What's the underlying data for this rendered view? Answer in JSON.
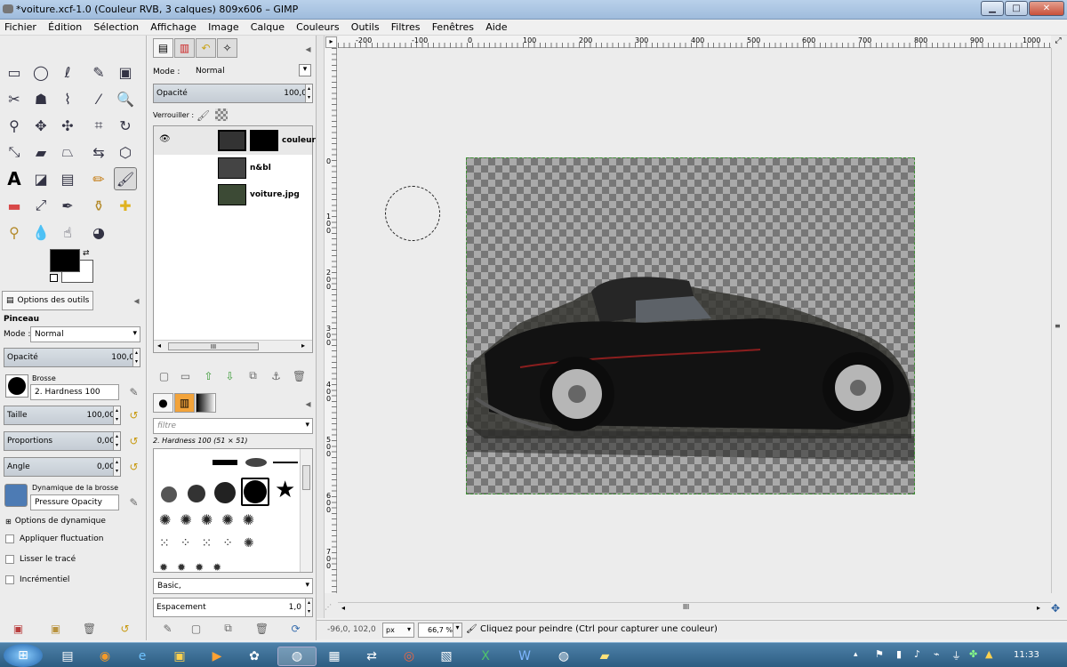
{
  "window": {
    "title": "*voiture.xcf-1.0 (Couleur RVB, 3 calques) 809x606 – GIMP",
    "minimize": "▁",
    "maximize": "□",
    "close": "✕"
  },
  "menu": [
    "Fichier",
    "Édition",
    "Sélection",
    "Affichage",
    "Image",
    "Calque",
    "Couleurs",
    "Outils",
    "Filtres",
    "Fenêtres",
    "Aide"
  ],
  "toolbox": {
    "tools": [
      "rect-select",
      "ellipse-select",
      "lasso",
      "fuzzy-select",
      "color-select",
      "scissors",
      "foreground-select",
      "paths",
      "color-picker",
      "zoom",
      "measure",
      "move",
      "align",
      "crop",
      "rotate",
      "scale",
      "shear",
      "perspective",
      "flip",
      "cage",
      "text",
      "bucket-fill",
      "blend",
      "pencil",
      "paintbrush",
      "eraser",
      "airbrush",
      "ink",
      "clone",
      "heal",
      "perspective-clone",
      "blur",
      "smudge",
      "dodge-burn"
    ],
    "foreground": "#000000",
    "background": "#ffffff"
  },
  "toolOptions": {
    "tabTitle": "Options des outils",
    "toolName": "Pinceau",
    "modeLabel": "Mode :",
    "mode": "Normal",
    "opacityLabel": "Opacité",
    "opacityValue": "100,0",
    "brushLabel": "Brosse",
    "brushName": "2. Hardness 100",
    "sizeLabel": "Taille",
    "sizeValue": "100,00",
    "ratioLabel": "Proportions",
    "ratioValue": "0,00",
    "angleLabel": "Angle",
    "angleValue": "0,00",
    "dynamicsLabel": "Dynamique de la brosse",
    "dynamicsName": "Pressure Opacity",
    "dynamicsOptions": "Options de dynamique",
    "applyJitter": "Appliquer fluctuation",
    "smoothStroke": "Lisser le tracé",
    "incremental": "Incrémentiel"
  },
  "layers": {
    "modeLabel": "Mode :",
    "mode": "Normal",
    "opacityLabel": "Opacité",
    "opacityValue": "100,0",
    "lockLabel": "Verrouiller :",
    "items": [
      {
        "name": "couleur"
      },
      {
        "name": "n&bl"
      },
      {
        "name": "voiture.jpg"
      }
    ],
    "scrollMid": "III"
  },
  "brushes": {
    "filterPlaceholder": "filtre",
    "selected": "2. Hardness 100 (51 × 51)",
    "preset": "Basic,",
    "spacingLabel": "Espacement",
    "spacingValue": "1,0"
  },
  "rulers": {
    "h": [
      "-200",
      "-100",
      "0",
      "100",
      "200",
      "300",
      "400",
      "500",
      "600",
      "700",
      "800",
      "900",
      "1000"
    ],
    "v": [
      "0",
      "1 0 0",
      "2 0 0",
      "3 0 0",
      "4 0 0",
      "5 0 0",
      "6 0 0",
      "7 0 0"
    ]
  },
  "status": {
    "coords": "-96,0, 102,0",
    "unit": "px",
    "zoom": "66,7 %",
    "message": "Cliquez pour peindre (Ctrl pour capturer une couleur)"
  },
  "canvas": {
    "hscrollMid": "III",
    "navIcon": "✥"
  },
  "taskbar": {
    "clock": "11:33"
  }
}
